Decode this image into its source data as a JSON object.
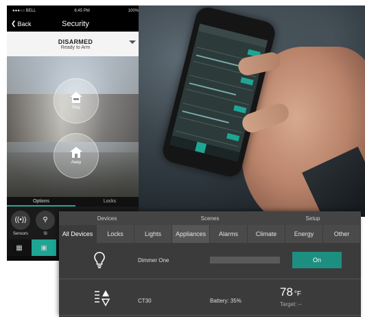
{
  "phone": {
    "status": {
      "carrier": "●●●○○ BELL",
      "time": "6:45 PM",
      "battery": "100%"
    },
    "nav": {
      "back": "Back",
      "title": "Security"
    },
    "arm": {
      "state": "DISARMED",
      "substate": "Ready to Arm"
    },
    "buttons": [
      {
        "label": "Stay"
      },
      {
        "label": "Away"
      }
    ],
    "tabs": [
      "Options",
      "Locks"
    ],
    "actions": [
      {
        "label": "Sensors"
      },
      {
        "label": "Sl"
      }
    ]
  },
  "panel": {
    "sections": [
      "Devices",
      "Scenes",
      "Setup"
    ],
    "categories": [
      "All Devices",
      "Locks",
      "Lights",
      "Appliances",
      "Alarms",
      "Climate",
      "Energy",
      "Other"
    ],
    "devices": [
      {
        "name": "Dimmer One",
        "button": "On"
      },
      {
        "name": "CT30",
        "battery": "Battery: 35%",
        "temp": "78",
        "unit": "°F",
        "target": "Target: --"
      }
    ]
  },
  "colors": {
    "accent": "#1ea594",
    "panel_bg": "#3b3b3b"
  }
}
